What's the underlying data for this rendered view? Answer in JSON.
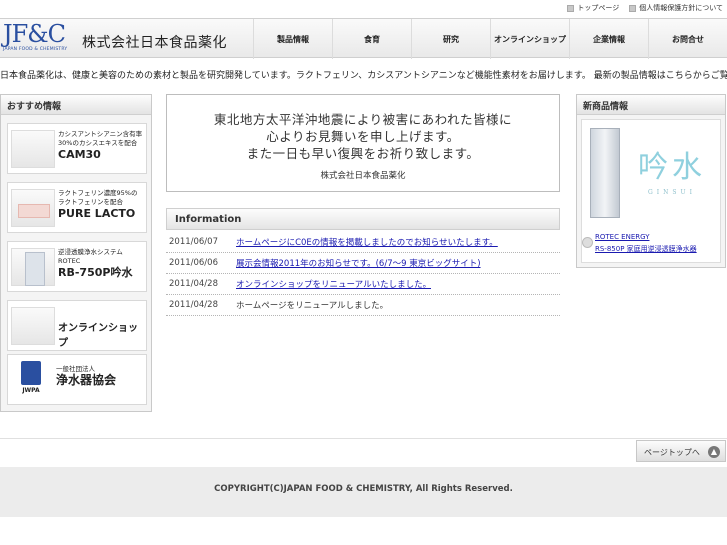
{
  "util_links": [
    "トップページ",
    "個人情報保護方針について"
  ],
  "logo": {
    "big": "JF&C",
    "small": "JAPAN FOOD & CHEMISTRY"
  },
  "company": "株式会社日本食品薬化",
  "nav": [
    "製品情報",
    "食育",
    "研究",
    "オンラインショップ",
    "企業情報",
    "お問合せ"
  ],
  "ticker": "日本食品薬化は、健康と美容のための素材と製品を研究開発しています。ラクトフェリン、カシスアントシアニンなど機能性素材をお届けします。 最新の製品情報はこちらからご覧いただけます。",
  "sidebar": {
    "title": "おすすめ情報",
    "banners": [
      {
        "line1": "カシスアントシアニン含有率",
        "line2": "30%のカシスエキスを配合",
        "name": "CAM30"
      },
      {
        "line1": "ラクトフェリン濃度95%の",
        "line2": "ラクトフェリンを配合",
        "name": "PURE LACTO"
      },
      {
        "line1": "逆浸透膜浄水システム",
        "line2": "ROTEC",
        "name": "RB-750P吟水"
      },
      {
        "name": "オンラインショップ"
      },
      {
        "line1": "一般社団法人",
        "name": "浄水器協会",
        "logo": "JWPA"
      }
    ]
  },
  "message": {
    "lines": [
      "東北地方太平洋沖地震により被害にあわれた皆様に",
      "心よりお見舞いを申し上げます。",
      "また一日も早い復興をお祈り致します。"
    ],
    "signature": "株式会社日本食品薬化"
  },
  "info": {
    "title": "Information",
    "items": [
      {
        "date": "2011/06/07",
        "text": "ホームページにC0Eの情報を掲載しましたのでお知らせいたします。",
        "link": true
      },
      {
        "date": "2011/06/06",
        "text": "展示会情報2011年のお知らせです。(6/7～9 東京ビッグサイト)",
        "link": true
      },
      {
        "date": "2011/04/28",
        "text": "オンラインショップをリニューアルいたしました。",
        "link": true
      },
      {
        "date": "2011/04/28",
        "text": "ホームページをリニューアルしました。",
        "link": false
      }
    ]
  },
  "new_products": {
    "title": "新商品情報",
    "logo": "吟水",
    "logo_sub": "GINSUI",
    "link_line1": "ROTEC ENERGY",
    "link_line2": "RS-850P 家庭用逆浸透膜浄水器"
  },
  "pagetop": "ページトップへ",
  "copyright": "COPYRIGHT(C)JAPAN FOOD & CHEMISTRY, All Rights Reserved."
}
